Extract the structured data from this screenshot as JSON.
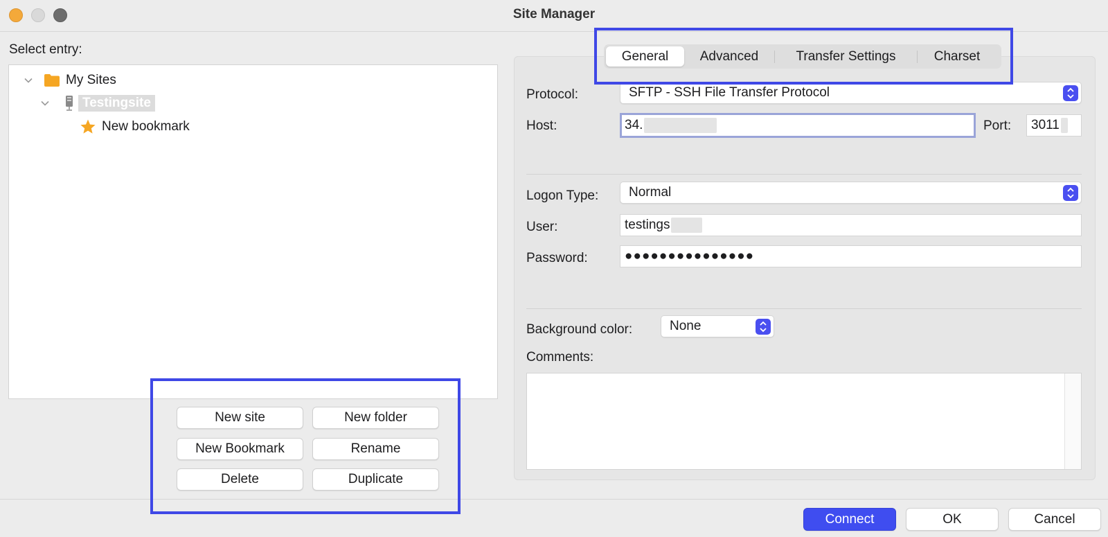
{
  "window": {
    "title": "Site Manager"
  },
  "left": {
    "select_label": "Select entry:",
    "tree": {
      "root": {
        "label": "My Sites",
        "icon": "folder-icon"
      },
      "site": {
        "label": "Testingsite",
        "icon": "server-icon"
      },
      "bookmark": {
        "label": "New bookmark",
        "icon": "star-icon"
      }
    },
    "buttons": {
      "new_site": "New site",
      "new_folder": "New folder",
      "new_bookmark": "New Bookmark",
      "rename": "Rename",
      "delete": "Delete",
      "duplicate": "Duplicate"
    }
  },
  "tabs": [
    {
      "label": "General",
      "active": true
    },
    {
      "label": "Advanced",
      "active": false
    },
    {
      "label": "Transfer Settings",
      "active": false
    },
    {
      "label": "Charset",
      "active": false
    }
  ],
  "general": {
    "protocol_label": "Protocol:",
    "protocol_value": "SFTP - SSH File Transfer Protocol",
    "host_label": "Host:",
    "host_value": "34.",
    "port_label": "Port:",
    "port_value": "3011",
    "logon_type_label": "Logon Type:",
    "logon_type_value": "Normal",
    "user_label": "User:",
    "user_value": "testings",
    "password_label": "Password:",
    "password_value": "●●●●●●●●●●●●●●●",
    "bg_color_label": "Background color:",
    "bg_color_value": "None",
    "comments_label": "Comments:"
  },
  "footer": {
    "connect": "Connect",
    "ok": "OK",
    "cancel": "Cancel"
  },
  "colors": {
    "accent": "#3f4df0",
    "highlight_box": "#3f48e6",
    "folder": "#f5a623",
    "star": "#f5a623"
  }
}
